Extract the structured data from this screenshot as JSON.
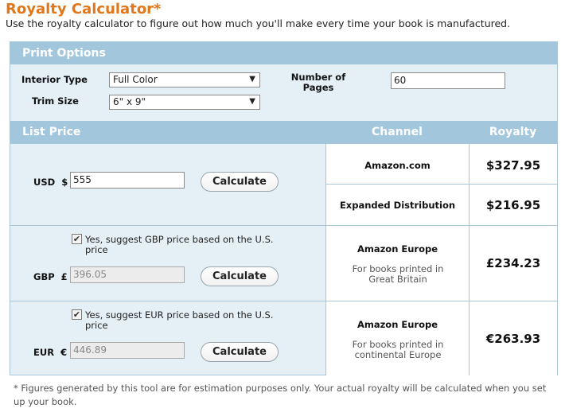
{
  "header": {
    "title": "Royalty Calculator*",
    "subtitle": "Use the royalty calculator to figure out how much you'll make every time your book is manufactured."
  },
  "print_options": {
    "heading": "Print Options",
    "interior_type_label": "Interior Type",
    "interior_type_value": "Full Color",
    "trim_size_label": "Trim Size",
    "trim_size_value": "6\" x 9\"",
    "pages_label_line1": "Number of",
    "pages_label_line2": "Pages",
    "pages_value": "60"
  },
  "columns": {
    "list_price": "List Price",
    "channel": "Channel",
    "royalty": "Royalty"
  },
  "usd": {
    "label": "USD",
    "symbol": "$",
    "value": "555",
    "button": "Calculate",
    "channels": [
      {
        "name": "Amazon.com",
        "royalty": "$327.95"
      },
      {
        "name": "Expanded Distribution",
        "royalty": "$216.95"
      }
    ]
  },
  "gbp": {
    "checkbox_label": "Yes, suggest GBP price based on the U.S. price",
    "checked": true,
    "label": "GBP",
    "symbol": "£",
    "value": "396.05",
    "button": "Calculate",
    "channel_name": "Amazon Europe",
    "channel_sub": "For books printed in Great Britain",
    "royalty": "£234.23"
  },
  "eur": {
    "checkbox_label": "Yes, suggest EUR price based on the U.S. price",
    "checked": true,
    "label": "EUR",
    "symbol": "€",
    "value": "446.89",
    "button": "Calculate",
    "channel_name": "Amazon Europe",
    "channel_sub": "For books printed in continental Europe",
    "royalty": "€263.93"
  },
  "footnote": "* Figures generated by this tool are for estimation purposes only. Your actual royalty will be calculated when you set up your book.",
  "icons": {
    "dropdown": "chevron-down-icon",
    "checkbox": "checkmark-icon"
  },
  "colors": {
    "title": "#e0771a",
    "header_bar": "#a2c7dc",
    "panel_bg": "#e4f0f6",
    "border": "#a9c7d9"
  }
}
